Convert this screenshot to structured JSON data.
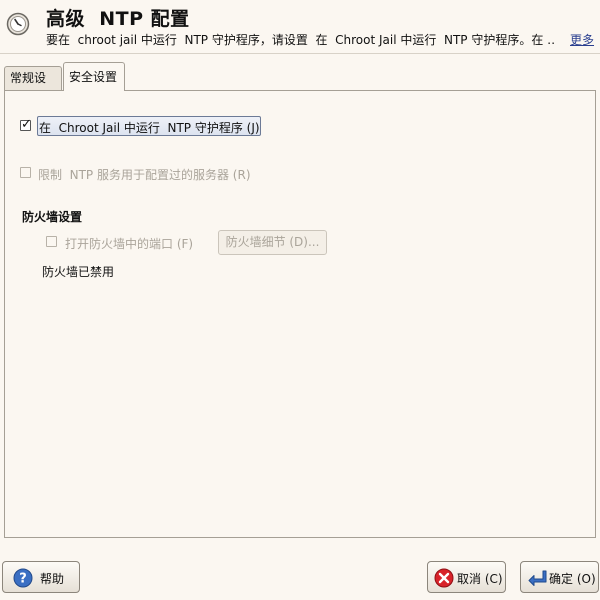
{
  "header": {
    "title": "高级  NTP 配置",
    "description": "要在  chroot jail 中运行  NTP 守护程序，请设置  在  Chroot Jail 中运行  NTP 守护程序。在 …",
    "more_link": "更多"
  },
  "tabs": [
    {
      "label": "常规设置",
      "selected": false
    },
    {
      "label": "安全设置",
      "selected": true
    }
  ],
  "security": {
    "chroot_checkbox": {
      "label": "在  Chroot Jail 中运行  NTP 守护程序 (J)",
      "checked": true,
      "enabled": true
    },
    "restrict_checkbox": {
      "label": "限制  NTP 服务用于配置过的服务器 (R)",
      "checked": false,
      "enabled": false
    },
    "firewall": {
      "section_title": "防火墙设置",
      "open_port_checkbox": {
        "label": "打开防火墙中的端口 (F)",
        "checked": false,
        "enabled": false
      },
      "details_button": "防火墙细节 (D)...",
      "status": "防火墙已禁用"
    }
  },
  "buttons": {
    "help": "帮助",
    "cancel": "取消 (C)",
    "ok": "确定 (O)"
  },
  "colors": {
    "background": "#fbf7f1",
    "link": "#2a3f8f",
    "cancel_icon": "#d8232a",
    "ok_icon": "#3b6fc4"
  }
}
